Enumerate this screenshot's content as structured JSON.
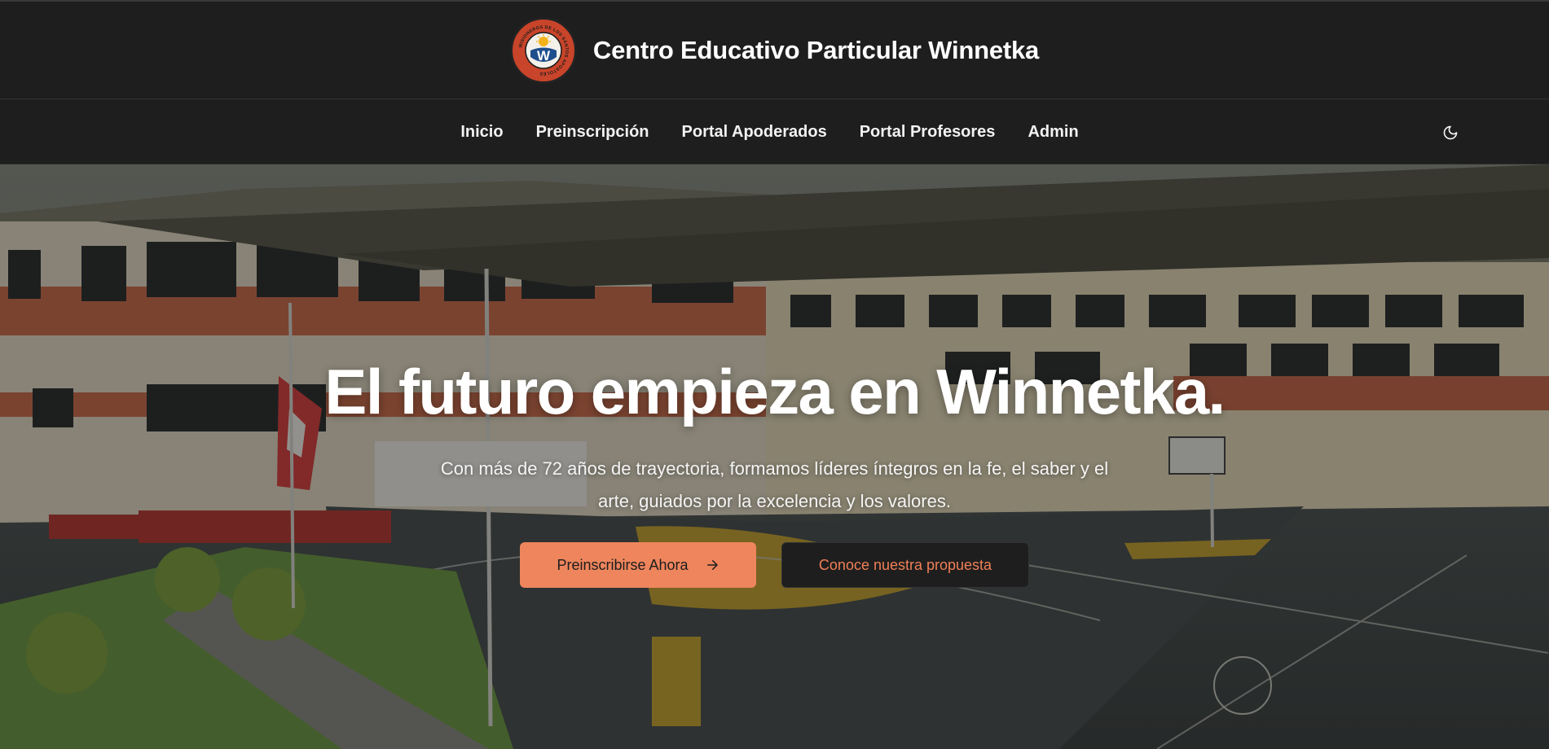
{
  "header": {
    "school_name": "Centro Educativo Particular Winnetka",
    "logo_letter": "W",
    "logo_ring_text": "MISIONEROS DE LOS SANTOS APOSTOLES"
  },
  "nav": {
    "items": [
      {
        "label": "Inicio"
      },
      {
        "label": "Preinscripción"
      },
      {
        "label": "Portal Apoderados"
      },
      {
        "label": "Portal Profesores"
      },
      {
        "label": "Admin"
      }
    ],
    "theme_toggle_icon": "moon-icon"
  },
  "hero": {
    "title": "El futuro empieza en Winnetka.",
    "subtitle": "Con más de 72 años de trayectoria, formamos líderes íntegros en la fe, el saber y el arte, guiados por la excelencia y los valores.",
    "primary_button": "Preinscribirse Ahora",
    "primary_button_icon": "arrow-right-icon",
    "secondary_button": "Conoce nuestra propuesta"
  },
  "colors": {
    "background": "#1e1e1e",
    "accent": "#ee855c",
    "accent_text": "#f07f56"
  }
}
